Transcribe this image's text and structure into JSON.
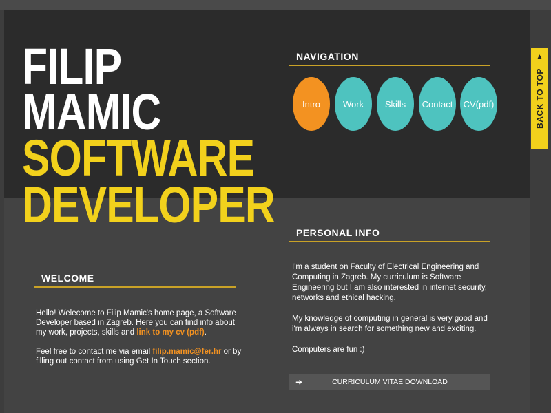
{
  "hero": {
    "first_name": "FILIP",
    "last_name": "MAMIC",
    "role_line1": "SOFTWARE",
    "role_line2": "DEVELOPER"
  },
  "navigation": {
    "title": "NAVIGATION",
    "items": [
      {
        "label": "Intro",
        "active": true
      },
      {
        "label": "Work",
        "active": false
      },
      {
        "label": "Skills",
        "active": false
      },
      {
        "label": "Contact",
        "active": false
      },
      {
        "label": "CV(pdf)",
        "active": false
      }
    ]
  },
  "back_to_top": {
    "label": "BACK TO TOP",
    "icon": "triangle-up-icon"
  },
  "welcome": {
    "title": "WELCOME",
    "p1_text": "Hello! Welecome to Filip Mamic's home page, a Software Developer based in Zagreb. Here you can find info about my work, projects, skills and ",
    "p1_link": "link to my cv (pdf)",
    "p1_end": ".",
    "p2_text": "Feel free to contact me via email ",
    "p2_email": "filip.mamic@fer.hr",
    "p2_end": " or by filling out contact from using Get In Touch section."
  },
  "personal": {
    "title": "PERSONAL INFO",
    "p1": "I'm a student on Faculty of Electrical Engineering and Computing in Zagreb. My curriculum is Software Engineering but I am also interested in internet security, networks and ethical hacking.",
    "p2": "My knowledge of computing in general is very good and i'm always in search for something new and exciting.",
    "p3": "Computers are fun :)",
    "cv_button": "CURRICULUM VITAE DOWNLOAD",
    "cv_icon": "arrow-right-icon"
  },
  "colors": {
    "accent_yellow": "#f2d11c",
    "accent_orange": "#f39221",
    "accent_teal": "#4ec3bf"
  }
}
